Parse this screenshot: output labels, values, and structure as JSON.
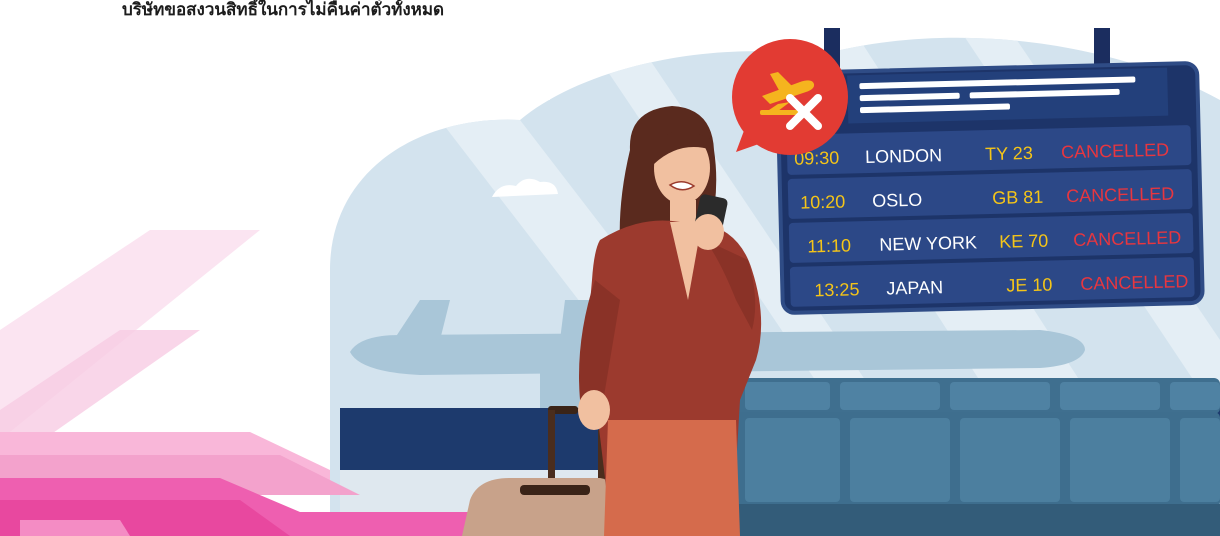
{
  "caption": "บริษัทขอสงวนสิทธิ์ในการไม่คืนค่าตั๋วทั้งหมด",
  "board": {
    "rows": [
      {
        "time": "09:30",
        "city": "LONDON",
        "flight": "TY 23",
        "status": "CANCELLED"
      },
      {
        "time": "10:20",
        "city": "OSLO",
        "flight": "GB 81",
        "status": "CANCELLED"
      },
      {
        "time": "11:10",
        "city": "NEW YORK",
        "flight": "KE 70",
        "status": "CANCELLED"
      },
      {
        "time": "13:25",
        "city": "JAPAN",
        "flight": "JE 10",
        "status": "CANCELLED"
      }
    ]
  },
  "colors": {
    "board_bg": "#27417a",
    "time": "#f5c518",
    "status": "#e8363f",
    "bubble": "#e23b33",
    "pink": "#f06fb6",
    "coat": "#9c3a2e",
    "skirt": "#d56b4c",
    "seats": "#3e6e8e"
  },
  "icons": [
    "plane-cancelled-icon",
    "close-icon"
  ]
}
